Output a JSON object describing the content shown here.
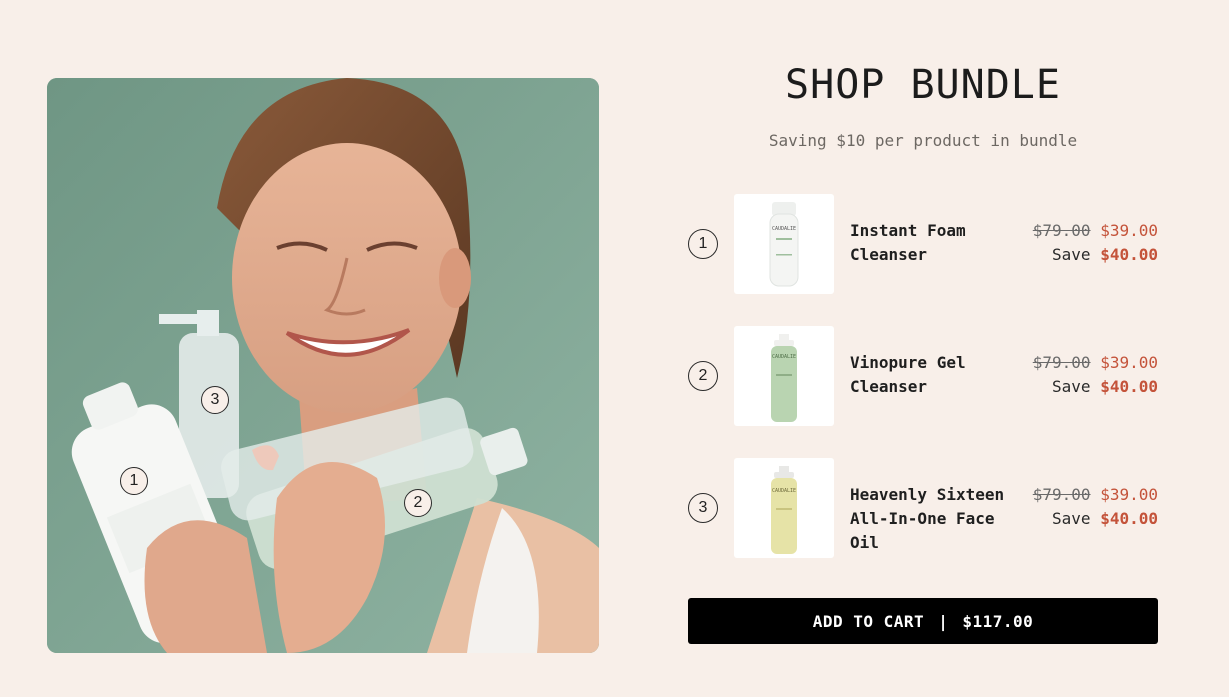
{
  "bundle": {
    "title": "SHOP BUNDLE",
    "subtitle": "Saving $10 per product in bundle"
  },
  "hotspots": [
    "1",
    "2",
    "3"
  ],
  "items": [
    {
      "number": "1",
      "name": "Instant Foam Cleanser",
      "original_price": "$79.00",
      "sale_price": "$39.00",
      "save_label": "Save",
      "save_amount": "$40.00",
      "thumb_icon": "foam-bottle"
    },
    {
      "number": "2",
      "name": "Vinopure Gel Cleanser",
      "original_price": "$79.00",
      "sale_price": "$39.00",
      "save_label": "Save",
      "save_amount": "$40.00",
      "thumb_icon": "green-pump-bottle"
    },
    {
      "number": "3",
      "name": "Heavenly Sixteen All-In-One Face Oil",
      "original_price": "$79.00",
      "sale_price": "$39.00",
      "save_label": "Save",
      "save_amount": "$40.00",
      "thumb_icon": "yellow-pump-bottle"
    }
  ],
  "cart": {
    "label": "ADD TO CART",
    "separator": "|",
    "total": "$117.00"
  },
  "colors": {
    "background": "#f8efe9",
    "sale": "#c4533a",
    "button": "#000000"
  }
}
